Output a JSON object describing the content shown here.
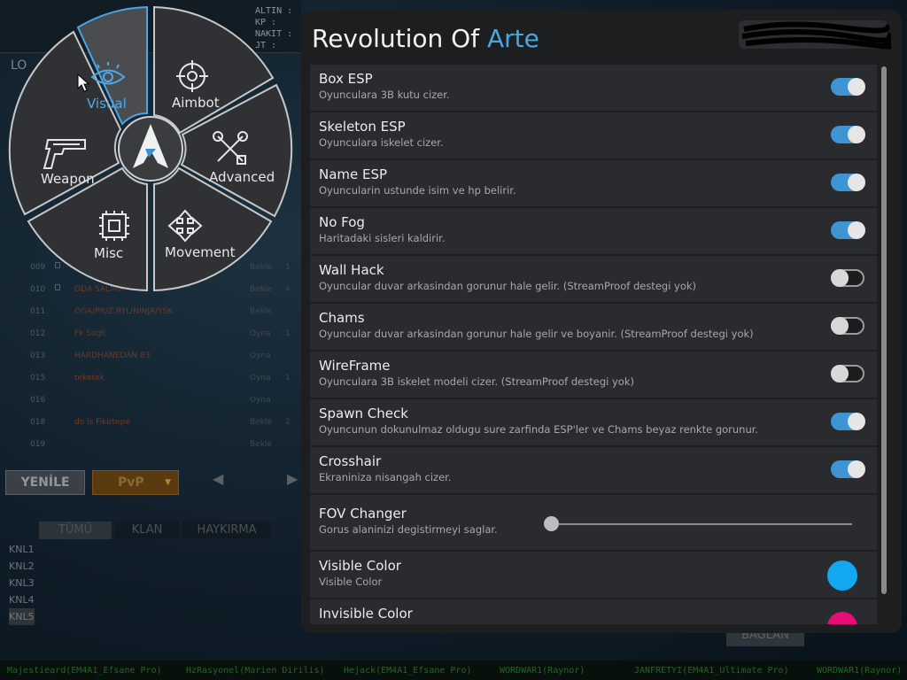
{
  "colors": {
    "accent": "#46a8e0",
    "toggle_on": "#3f95d4",
    "panel_bg": "#1d1e20",
    "item_bg": "#2a2b2e",
    "visible_color": "#12a8f0",
    "invisible_color": "#e80c78"
  },
  "game": {
    "stats": {
      "gold": "ALTIN :",
      "kp": "KP :",
      "nakit": "NAKIT :",
      "jt": "JT :"
    },
    "lobby_label": "LO",
    "rooms": [
      {
        "no": "009",
        "locked": true,
        "name": "",
        "status": "Bekle",
        "count": "1"
      },
      {
        "no": "010",
        "locked": true,
        "name": "ODA SALIMA",
        "status": "Bekle",
        "count": "4"
      },
      {
        "no": "011",
        "locked": false,
        "name": "OGA/PR/Z.RYL/NINJA/YSK",
        "status": "Bekle",
        "count": ""
      },
      {
        "no": "012",
        "locked": false,
        "name": "Fk Sogli",
        "status": "Oyna",
        "count": "1"
      },
      {
        "no": "013",
        "locked": false,
        "name": "HARDHANEDAN 83",
        "status": "Oyna",
        "count": ""
      },
      {
        "no": "015",
        "locked": false,
        "name": "teketek",
        "status": "Oyna",
        "count": "1"
      },
      {
        "no": "016",
        "locked": false,
        "name": "",
        "status": "Oyna",
        "count": ""
      },
      {
        "no": "018",
        "locked": false,
        "name": "do is Fikirtepe",
        "status": "Bekle",
        "count": "2"
      },
      {
        "no": "019",
        "locked": false,
        "name": "",
        "status": "Bekle",
        "count": ""
      }
    ],
    "refresh_button": "YENİLE",
    "mode_select": "PvP",
    "chat_tabs": [
      "TÜMÜ",
      "KLAN",
      "HAYKIRMA"
    ],
    "channels": [
      "KNL1",
      "KNL2",
      "KNL3",
      "KNL4",
      "KNL5"
    ],
    "connect_button": "BAĞLAN",
    "ticker": [
      "Majestieard(EM4A1_Efsane Pro)",
      "HzRasyonel(Marien Dirilis)",
      "Hejack(EM4A1_Efsane Pro)",
      "WORDWAR1(Raynor)",
      "JANFRETYI(EM4A1_Ultimate Pro)",
      "WORDWAR1(Raynor)"
    ]
  },
  "radial": {
    "segments": {
      "visual": {
        "label": "Visual",
        "icon": "eye-icon",
        "active": true
      },
      "aimbot": {
        "label": "Aimbot",
        "icon": "crosshair-icon",
        "active": false
      },
      "advanced": {
        "label": "Advanced",
        "icon": "tools-icon",
        "active": false
      },
      "movement": {
        "label": "Movement",
        "icon": "move-arrows-icon",
        "active": false
      },
      "misc": {
        "label": "Misc",
        "icon": "chip-icon",
        "active": false
      },
      "weapon": {
        "label": "Weapon",
        "icon": "pistol-icon",
        "active": false
      }
    },
    "center_logo": "arte-logo"
  },
  "panel": {
    "title_main": "Revolution Of ",
    "title_accent": "Arte",
    "items": [
      {
        "title": "Box ESP",
        "desc": "Oyunculara 3B kutu cizer.",
        "type": "toggle",
        "on": true
      },
      {
        "title": "Skeleton ESP",
        "desc": "Oyunculara iskelet cizer.",
        "type": "toggle",
        "on": true
      },
      {
        "title": "Name ESP",
        "desc": "Oyuncularin ustunde isim ve hp belirir.",
        "type": "toggle",
        "on": true
      },
      {
        "title": "No Fog",
        "desc": "Haritadaki sisleri kaldirir.",
        "type": "toggle",
        "on": true
      },
      {
        "title": "Wall Hack",
        "desc": "Oyuncular duvar arkasindan gorunur hale gelir. (StreamProof destegi yok)",
        "type": "toggle",
        "on": false
      },
      {
        "title": "Chams",
        "desc": "Oyuncular duvar arkasindan gorunur hale gelir ve boyanir. (StreamProof destegi yok)",
        "type": "toggle",
        "on": false
      },
      {
        "title": "WireFrame",
        "desc": "Oyunculara 3B iskelet modeli cizer. (StreamProof destegi yok)",
        "type": "toggle",
        "on": false
      },
      {
        "title": "Spawn Check",
        "desc": "Oyuncunun dokunulmaz oldugu sure zarfinda ESP'ler ve Chams beyaz renkte gorunur.",
        "type": "toggle",
        "on": true
      },
      {
        "title": "Crosshair",
        "desc": "Ekraniniza nisangah cizer.",
        "type": "toggle",
        "on": true
      },
      {
        "title": "FOV Changer",
        "desc": "Gorus alaninizi degistirmeyi saglar.",
        "type": "slider",
        "value": 0
      },
      {
        "title": "Visible Color",
        "desc": "Visible Color",
        "type": "color",
        "color": "#12a8f0"
      },
      {
        "title": "Invisible Color",
        "desc": "",
        "type": "color",
        "color": "#e80c78"
      }
    ]
  }
}
